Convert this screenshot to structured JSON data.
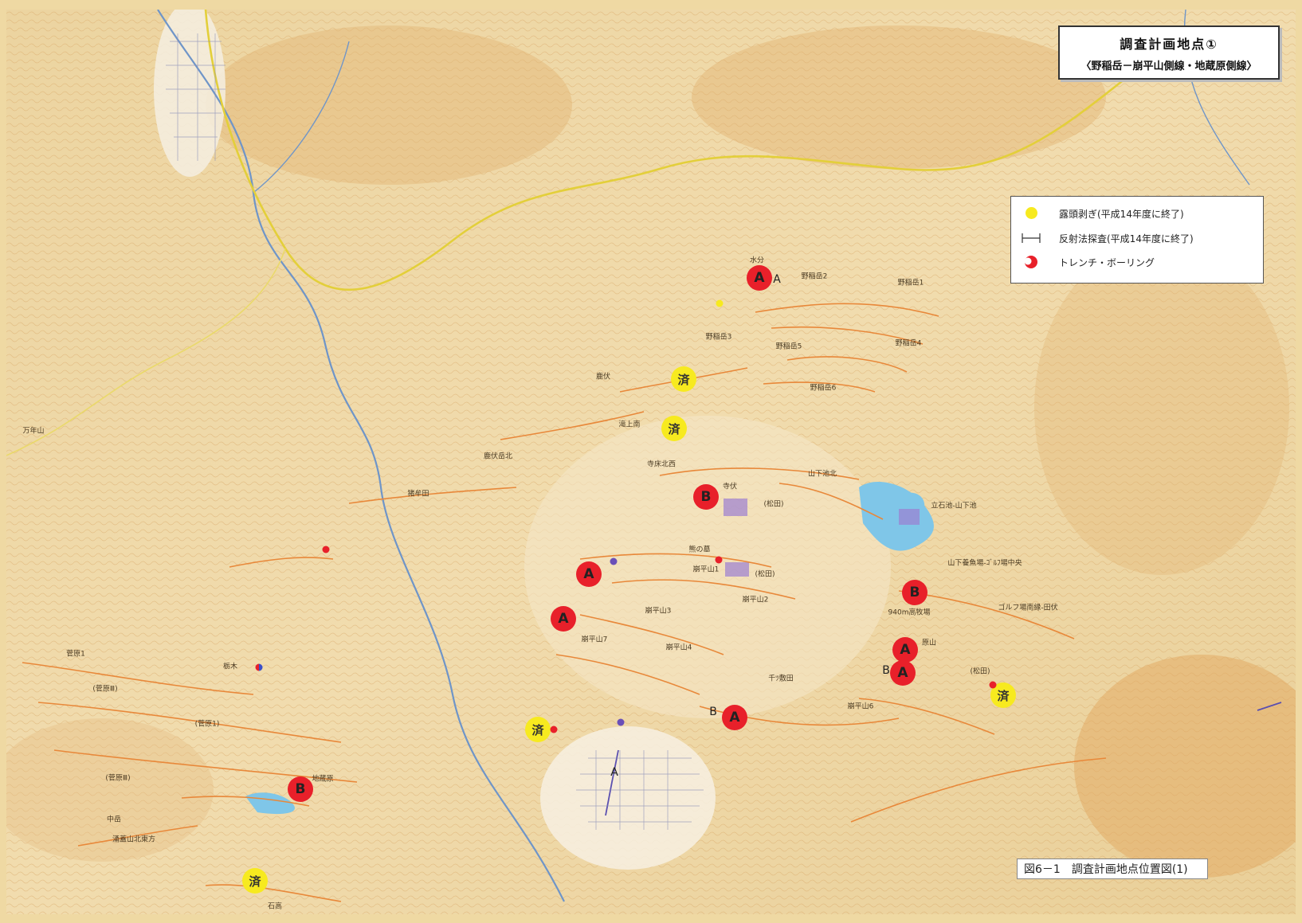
{
  "title": {
    "line1": "調査計画地点①",
    "line2": "〈野稲岳－崩平山側線・地蔵原側線〉"
  },
  "legend": {
    "items": [
      {
        "label": "露頭剥ぎ(平成14年度に終了)",
        "symbol": "yellow-dot"
      },
      {
        "label": "反射法探査(平成14年度に終了)",
        "symbol": "survey-line"
      },
      {
        "label": "トレンチ・ボーリング",
        "symbol": "red-dot"
      }
    ]
  },
  "caption": "図6－1　調査計画地点位置図(1)",
  "markers": {
    "red_a_1": "A",
    "red_a_2": "A",
    "red_a_3": "A",
    "red_a_4": "A",
    "red_a_5": "A",
    "red_a_6": "A",
    "red_b_1": "B",
    "red_b_2": "B",
    "red_b_3": "B",
    "done_1": "済",
    "done_2": "済",
    "done_3": "済",
    "done_4": "済",
    "done_5": "済",
    "side_a_1": "A",
    "side_b_1": "B",
    "side_b_2": "B",
    "line_a": "A"
  },
  "places": {
    "mizuwake": "水分",
    "noinedake1": "野稲岳1",
    "noinedake2": "野稲岳2",
    "noinedake3": "野稲岳3",
    "noinedake4": "野稲岳4",
    "noinedake5": "野稲岳5",
    "noinedake6": "野稲岳6",
    "shikabuse": "鹿伏",
    "takigamiminami": "滝上南",
    "shikabusedakekita": "鹿伏岳北",
    "teratokokitanishi": "寺床北西",
    "terafuse": "寺伏",
    "yamashitaikekita": "山下池北",
    "tateishiike": "立石池-山下池",
    "matsuda1": "(松田)",
    "matsuda2": "(松田)",
    "matsuda3": "(松田)",
    "inoseda": "猪牟田",
    "manensan": "万年山",
    "kuma": "熊の墓",
    "kuzurehirayama1": "崩平山1",
    "kuzurehirayama2": "崩平山2",
    "kuzurehirayama3": "崩平山3",
    "kuzurehirayama4": "崩平山4",
    "kuzurehirayama6": "崩平山6",
    "kuzurehirayama7": "崩平山7",
    "yamashitabokujo": "山下養魚場-ｺﾞﾙﾌ場中央",
    "golf": "ゴルフ場南縁-田伏",
    "bokujo940": "940m高牧場",
    "haramyama": "原山",
    "chida": "千ﾂ敷田",
    "sugehara1": "菅原1",
    "sugehara_p3a": "(菅原Ⅲ)",
    "sugehara_p1": "(菅原1)",
    "sugehara_p3b": "(菅原Ⅲ)",
    "tochigi": "栃木",
    "jizobaru": "地蔵原",
    "nakadake": "中岳",
    "wakuyama": "涌蓋山北東方",
    "ishidaka": "石高"
  }
}
